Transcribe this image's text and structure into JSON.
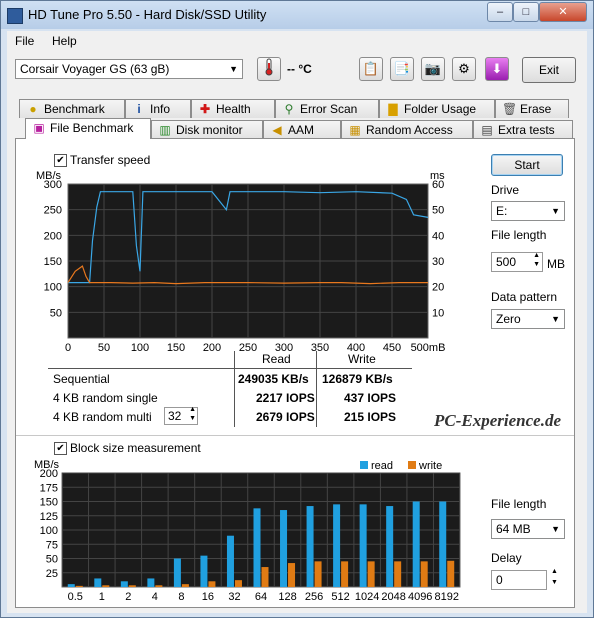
{
  "window": {
    "title": "HD Tune Pro 5.50 - Hard Disk/SSD Utility",
    "min": "–",
    "max": "□",
    "close": "✕"
  },
  "menu": [
    "File",
    "Help"
  ],
  "drive_select": "Corsair Voyager GS (63 gB)",
  "temperature": "-- °C",
  "exit_label": "Exit",
  "tabs_row1": [
    {
      "label": "Benchmark",
      "icon": "benchmark-icon"
    },
    {
      "label": "Info",
      "icon": "info-icon"
    },
    {
      "label": "Health",
      "icon": "health-icon"
    },
    {
      "label": "Error Scan",
      "icon": "error-scan-icon"
    },
    {
      "label": "Folder Usage",
      "icon": "folder-icon"
    },
    {
      "label": "Erase",
      "icon": "erase-icon"
    }
  ],
  "tabs_row2": [
    {
      "label": "File Benchmark",
      "icon": "file-benchmark-icon"
    },
    {
      "label": "Disk monitor",
      "icon": "disk-monitor-icon"
    },
    {
      "label": "AAM",
      "icon": "aam-icon"
    },
    {
      "label": "Random Access",
      "icon": "random-access-icon"
    },
    {
      "label": "Extra tests",
      "icon": "extra-tests-icon"
    }
  ],
  "transfer_speed_label": "Transfer speed",
  "block_size_label": "Block size measurement",
  "right_panel": {
    "start_label": "Start",
    "drive_label": "Drive",
    "drive_value": "E:",
    "file_length_label": "File length",
    "file_length_value": "500",
    "file_length_unit": "MB",
    "pattern_label": "Data pattern",
    "pattern_value": "Zero",
    "file_length_label_2": "File length",
    "file_length_value_2": "64 MB",
    "delay_label": "Delay",
    "delay_value": "0"
  },
  "results": {
    "read_header": "Read",
    "write_header": "Write",
    "rows": [
      {
        "label": "Sequential",
        "read": "249035 KB/s",
        "write": "126879 KB/s"
      },
      {
        "label": "4 KB random single",
        "read": "2217 IOPS",
        "write": "437 IOPS"
      },
      {
        "label": "4 KB random multi",
        "read": "2679 IOPS",
        "write": "215 IOPS"
      }
    ],
    "queue_depth": "32"
  },
  "watermark": "PC-Experience.de",
  "chart_data": [
    {
      "type": "line",
      "title": "",
      "ylabel_left": "MB/s",
      "ylabel_right": "ms",
      "xunit": "mB",
      "ylim_left": [
        0,
        300
      ],
      "ylim_right": [
        0,
        60
      ],
      "xlim": [
        0,
        500
      ],
      "x_ticks": [
        "0",
        "50",
        "100",
        "150",
        "200",
        "250",
        "300",
        "350",
        "400",
        "450",
        "500mB"
      ],
      "y_ticks_left": [
        "50",
        "100",
        "150",
        "200",
        "250",
        "300"
      ],
      "y_ticks_right": [
        "10",
        "20",
        "30",
        "40",
        "50",
        "60"
      ],
      "background": "#1b1b1b",
      "series": [
        {
          "color": "#3aa7e6",
          "axis": "left",
          "x": [
            0,
            30,
            34,
            40,
            45,
            90,
            95,
            100,
            104,
            150,
            200,
            220,
            225,
            250,
            300,
            350,
            400,
            450,
            470,
            480,
            500
          ],
          "values": [
            108,
            108,
            190,
            255,
            285,
            285,
            180,
            130,
            285,
            285,
            285,
            250,
            285,
            285,
            285,
            283,
            285,
            282,
            270,
            240,
            235
          ]
        },
        {
          "color": "#e8781e",
          "axis": "left",
          "x": [
            0,
            10,
            20,
            25,
            30,
            60,
            90,
            120,
            150,
            190,
            250,
            300,
            350,
            380,
            420,
            460,
            500
          ],
          "values": [
            108,
            130,
            140,
            120,
            108,
            108,
            107,
            108,
            106,
            108,
            108,
            107,
            108,
            108,
            106,
            108,
            108
          ]
        }
      ]
    },
    {
      "type": "bar",
      "title": "",
      "ylabel": "MB/s",
      "ylim": [
        0,
        200
      ],
      "y_ticks": [
        "25",
        "50",
        "75",
        "100",
        "125",
        "150",
        "175",
        "200"
      ],
      "categories": [
        "0.5",
        "1",
        "2",
        "4",
        "8",
        "16",
        "32",
        "64",
        "128",
        "256",
        "512",
        "1024",
        "2048",
        "4096",
        "8192"
      ],
      "background": "#1b1b1b",
      "legend": "top-right",
      "series": [
        {
          "name": "read",
          "color": "#20a0e0",
          "values": [
            5,
            15,
            10,
            15,
            50,
            55,
            90,
            138,
            135,
            142,
            145,
            145,
            142,
            150,
            150
          ]
        },
        {
          "name": "write",
          "color": "#e07b14",
          "values": [
            2,
            3,
            3,
            3,
            5,
            10,
            12,
            35,
            42,
            45,
            45,
            45,
            45,
            45,
            46
          ]
        }
      ]
    }
  ]
}
